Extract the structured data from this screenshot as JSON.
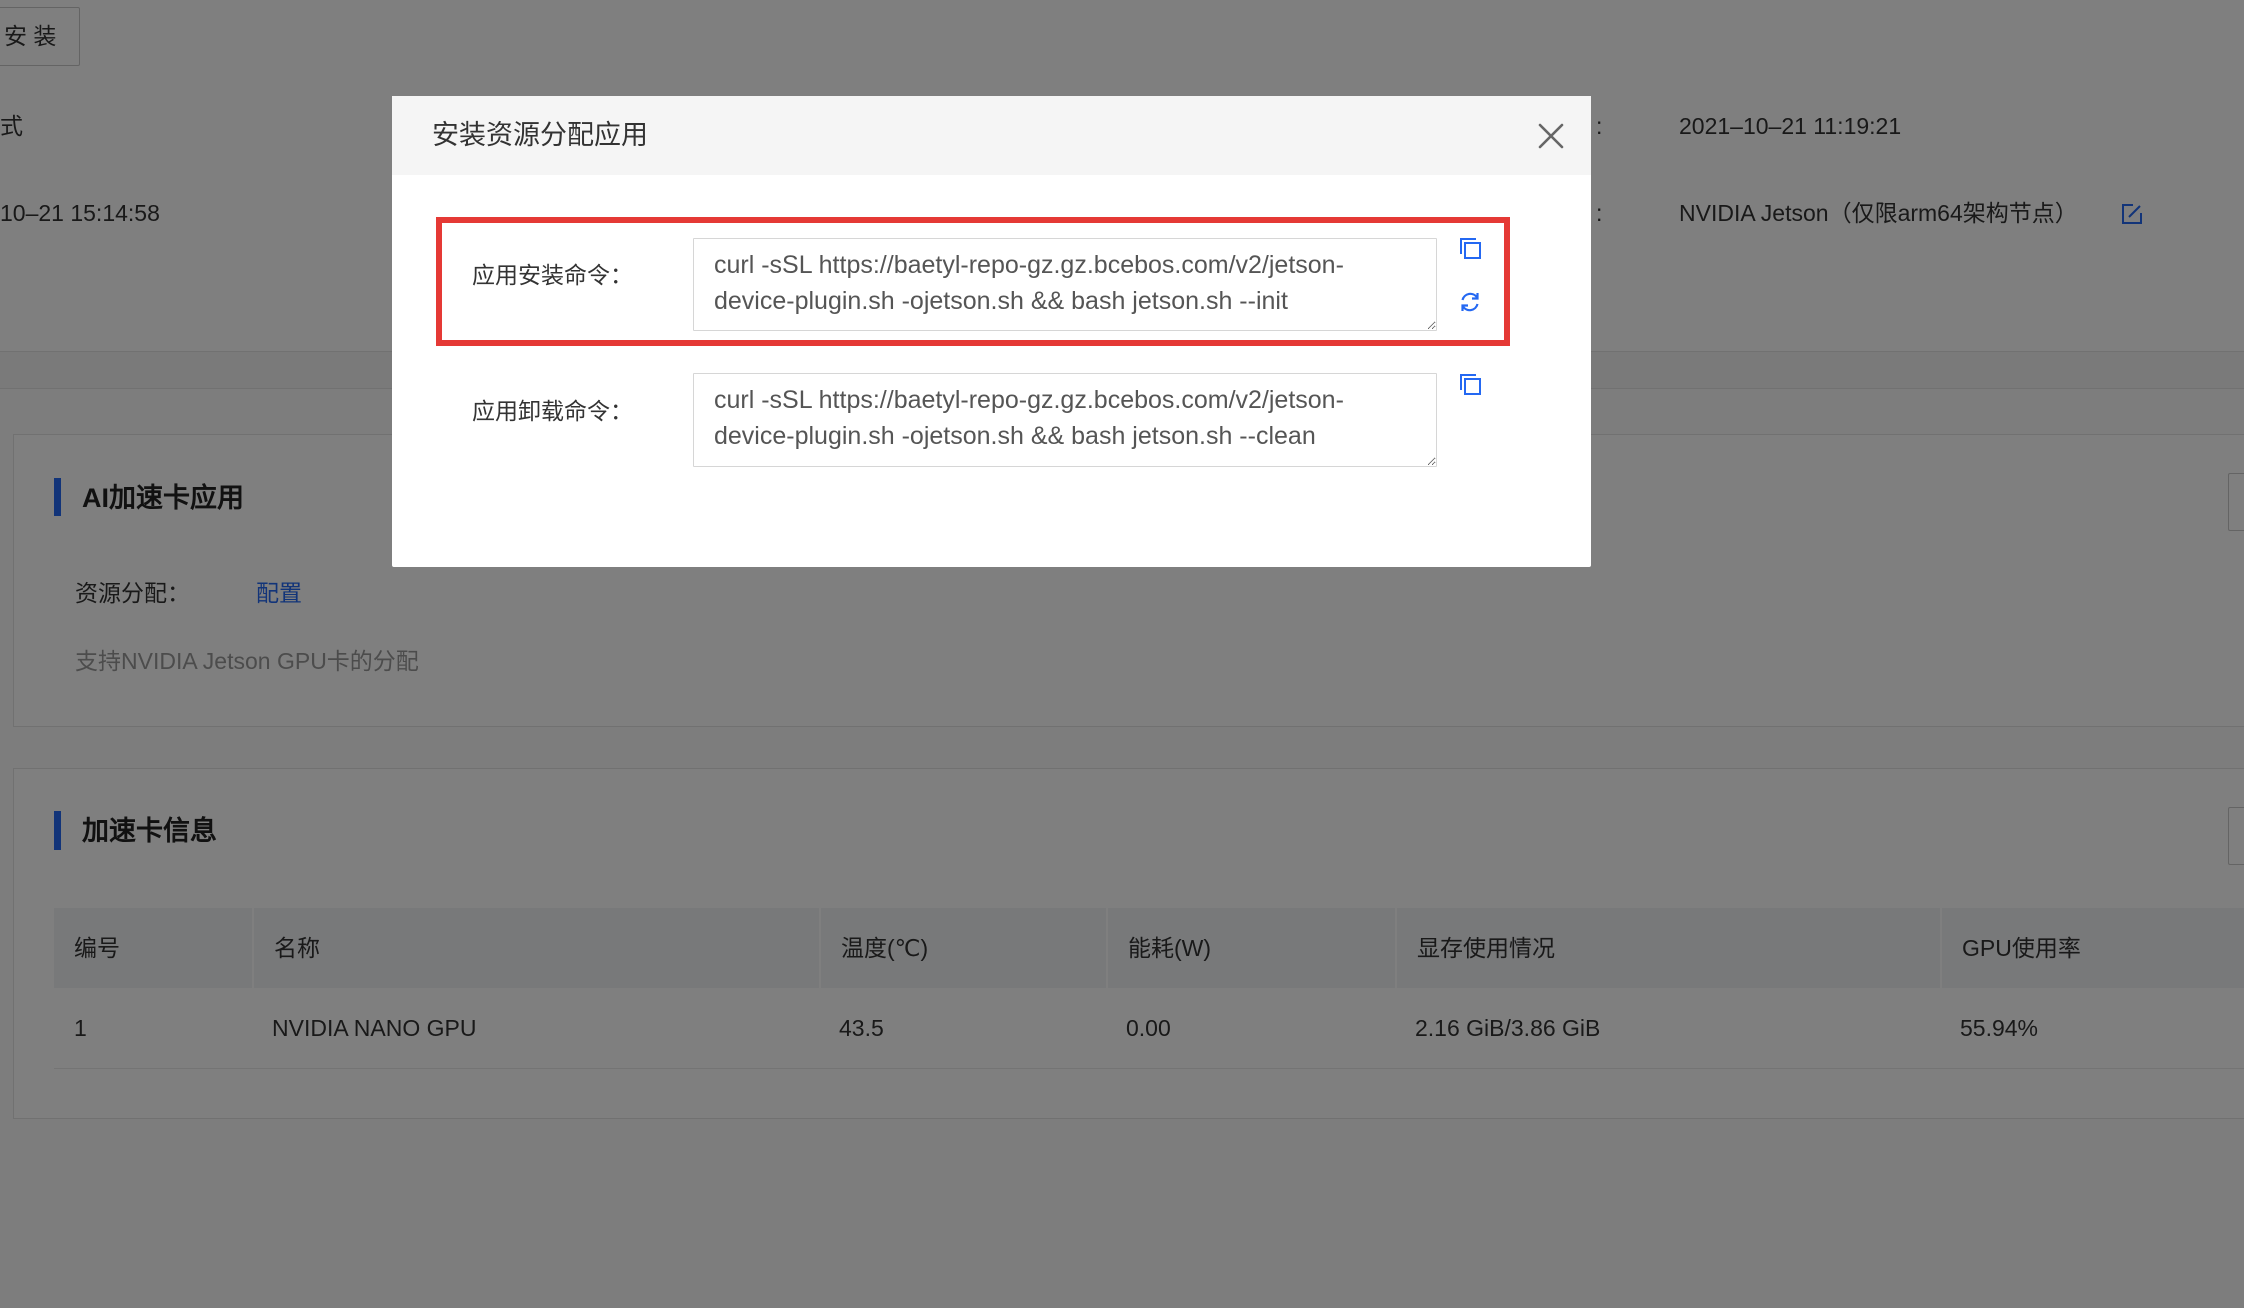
{
  "header": {
    "install_button": "安 装",
    "left_fields": [
      {
        "value": "式"
      },
      {
        "value": "10–21 15:14:58"
      }
    ],
    "right_fields": [
      {
        "separator": ":",
        "value": "2021–10–21 11:19:21"
      },
      {
        "separator": ":",
        "value": "NVIDIA Jetson（仅限arm64架构节点）"
      }
    ]
  },
  "ai_card": {
    "title": "AI加速卡应用",
    "resource_label": "资源分配：",
    "config_link": "配置",
    "description": "支持NVIDIA Jetson GPU卡的分配"
  },
  "accel_card": {
    "title": "加速卡信息",
    "columns": [
      "编号",
      "名称",
      "温度(℃)",
      "能耗(W)",
      "显存使用情况",
      "GPU使用率"
    ],
    "rows": [
      [
        "1",
        "NVIDIA NANO GPU",
        "43.5",
        "0.00",
        "2.16 GiB/3.86 GiB",
        "55.94%"
      ]
    ]
  },
  "modal": {
    "title": "安装资源分配应用",
    "install_label": "应用安装命令：",
    "install_command": "curl -sSL https://baetyl-repo-gz.gz.bcebos.com/v2/jetson-device-plugin.sh -ojetson.sh && bash jetson.sh --init",
    "uninstall_label": "应用卸载命令：",
    "uninstall_command": "curl -sSL https://baetyl-repo-gz.gz.bcebos.com/v2/jetson-device-plugin.sh -ojetson.sh && bash jetson.sh --clean"
  },
  "icons": {
    "close": "close-icon",
    "copy": "copy-icon",
    "refresh": "refresh-icon",
    "edit": "edit-icon"
  },
  "colors": {
    "accent": "#2468f2",
    "highlight_border": "#e53935",
    "mask": "rgba(0,0,0,0.5)"
  }
}
